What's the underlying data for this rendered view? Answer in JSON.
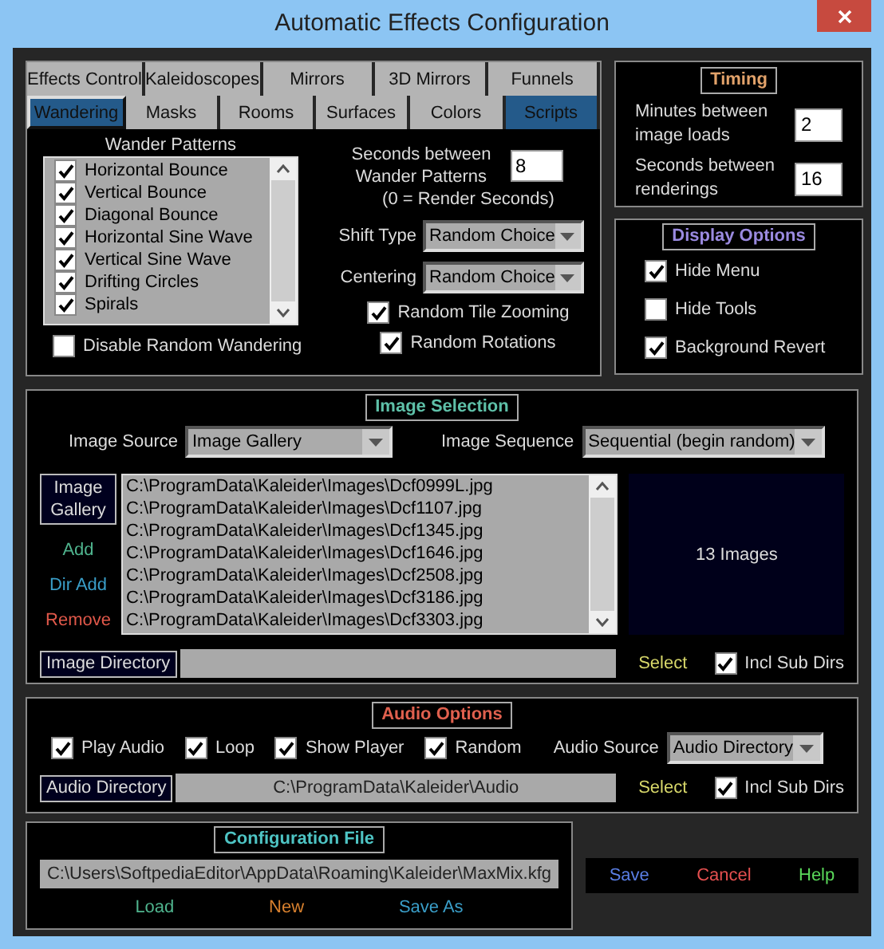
{
  "window": {
    "title": "Automatic Effects Configuration"
  },
  "tabs": {
    "rows": [
      {
        "tabs": [
          {
            "label": "Effects Control",
            "selected": false,
            "highlighted": false
          },
          {
            "label": "Kaleidoscopes",
            "selected": false,
            "highlighted": false
          },
          {
            "label": "Mirrors",
            "selected": false,
            "highlighted": false
          },
          {
            "label": "3D Mirrors",
            "selected": false,
            "highlighted": false
          },
          {
            "label": "Funnels",
            "selected": false,
            "highlighted": false
          }
        ]
      },
      {
        "tabs": [
          {
            "label": "Wandering",
            "selected": true,
            "highlighted": false
          },
          {
            "label": "Masks",
            "selected": false,
            "highlighted": false
          },
          {
            "label": "Rooms",
            "selected": false,
            "highlighted": false
          },
          {
            "label": "Surfaces",
            "selected": false,
            "highlighted": false
          },
          {
            "label": "Colors",
            "selected": false,
            "highlighted": false
          },
          {
            "label": "Scripts",
            "selected": false,
            "highlighted": true
          }
        ]
      }
    ]
  },
  "wandering": {
    "list_title": "Wander Patterns",
    "patterns": [
      {
        "label": "Horizontal Bounce",
        "checked": true
      },
      {
        "label": "Vertical Bounce",
        "checked": true
      },
      {
        "label": "Diagonal Bounce",
        "checked": true
      },
      {
        "label": "Horizontal Sine Wave",
        "checked": true
      },
      {
        "label": "Vertical Sine Wave",
        "checked": true
      },
      {
        "label": "Drifting Circles",
        "checked": true
      },
      {
        "label": "Spirals",
        "checked": true
      }
    ],
    "disable": {
      "label": "Disable Random Wandering",
      "checked": false
    },
    "seconds": {
      "label": "Seconds between Wander Patterns",
      "value": "8",
      "note": "(0 = Render Seconds)"
    },
    "dropdowns": [
      {
        "label": "Shift Type",
        "value": "Random Choice"
      },
      {
        "label": "Centering",
        "value": "Random Choice"
      }
    ],
    "options": [
      {
        "label": "Random Tile Zooming",
        "checked": true
      },
      {
        "label": "Random Rotations",
        "checked": true
      }
    ]
  },
  "timing": {
    "title": "Timing",
    "fields": [
      {
        "label": "Minutes between image loads",
        "value": "2"
      },
      {
        "label": "Seconds between renderings",
        "value": "16"
      }
    ]
  },
  "display_options": {
    "title": "Display Options",
    "options": [
      {
        "label": "Hide Menu",
        "checked": true
      },
      {
        "label": "Hide Tools",
        "checked": false
      },
      {
        "label": "Background Revert",
        "checked": true
      }
    ]
  },
  "image_selection": {
    "title": "Image Selection",
    "source": {
      "label": "Image Source",
      "value": "Image Gallery"
    },
    "sequence": {
      "label": "Image Sequence",
      "value": "Sequential (begin random)"
    },
    "gallery_button": "Image Gallery",
    "actions": [
      {
        "label": "Add",
        "color": "#4fb48e"
      },
      {
        "label": "Dir Add",
        "color": "#3a9ec8"
      },
      {
        "label": "Remove",
        "color": "#e0584a"
      }
    ],
    "files": [
      "C:\\ProgramData\\Kaleider\\Images\\Dcf0999L.jpg",
      "C:\\ProgramData\\Kaleider\\Images\\Dcf1107.jpg",
      "C:\\ProgramData\\Kaleider\\Images\\Dcf1345.jpg",
      "C:\\ProgramData\\Kaleider\\Images\\Dcf1646.jpg",
      "C:\\ProgramData\\Kaleider\\Images\\Dcf2508.jpg",
      "C:\\ProgramData\\Kaleider\\Images\\Dcf3186.jpg",
      "C:\\ProgramData\\Kaleider\\Images\\Dcf3303.jpg"
    ],
    "preview": "13 Images",
    "directory_button": "Image Directory",
    "select": "Select",
    "include_sub_dirs": {
      "label": "Incl Sub Dirs",
      "checked": true
    }
  },
  "audio_options": {
    "title": "Audio Options",
    "options": [
      {
        "label": "Play Audio",
        "checked": true
      },
      {
        "label": "Loop",
        "checked": true
      },
      {
        "label": "Show Player",
        "checked": true
      },
      {
        "label": "Random",
        "checked": true
      }
    ],
    "source": {
      "label": "Audio Source",
      "value": "Audio Directory"
    },
    "directory_button": "Audio Directory",
    "directory": "C:\\ProgramData\\Kaleider\\Audio",
    "select": "Select",
    "include_sub_dirs": {
      "label": "Incl Sub Dirs",
      "checked": true
    }
  },
  "configuration_file": {
    "title": "Configuration File",
    "path": "C:\\Users\\SoftpediaEditor\\AppData\\Roaming\\Kaleider\\MaxMix.kfg",
    "actions": [
      {
        "label": "Load",
        "color": "#4fb48e"
      },
      {
        "label": "New",
        "color": "#d8802e"
      },
      {
        "label": "Save As",
        "color": "#3a9ec8"
      }
    ]
  },
  "buttons": [
    {
      "label": "Save",
      "color": "#5a7fe6"
    },
    {
      "label": "Cancel",
      "color": "#e65050"
    },
    {
      "label": "Help",
      "color": "#5ad85a"
    }
  ]
}
